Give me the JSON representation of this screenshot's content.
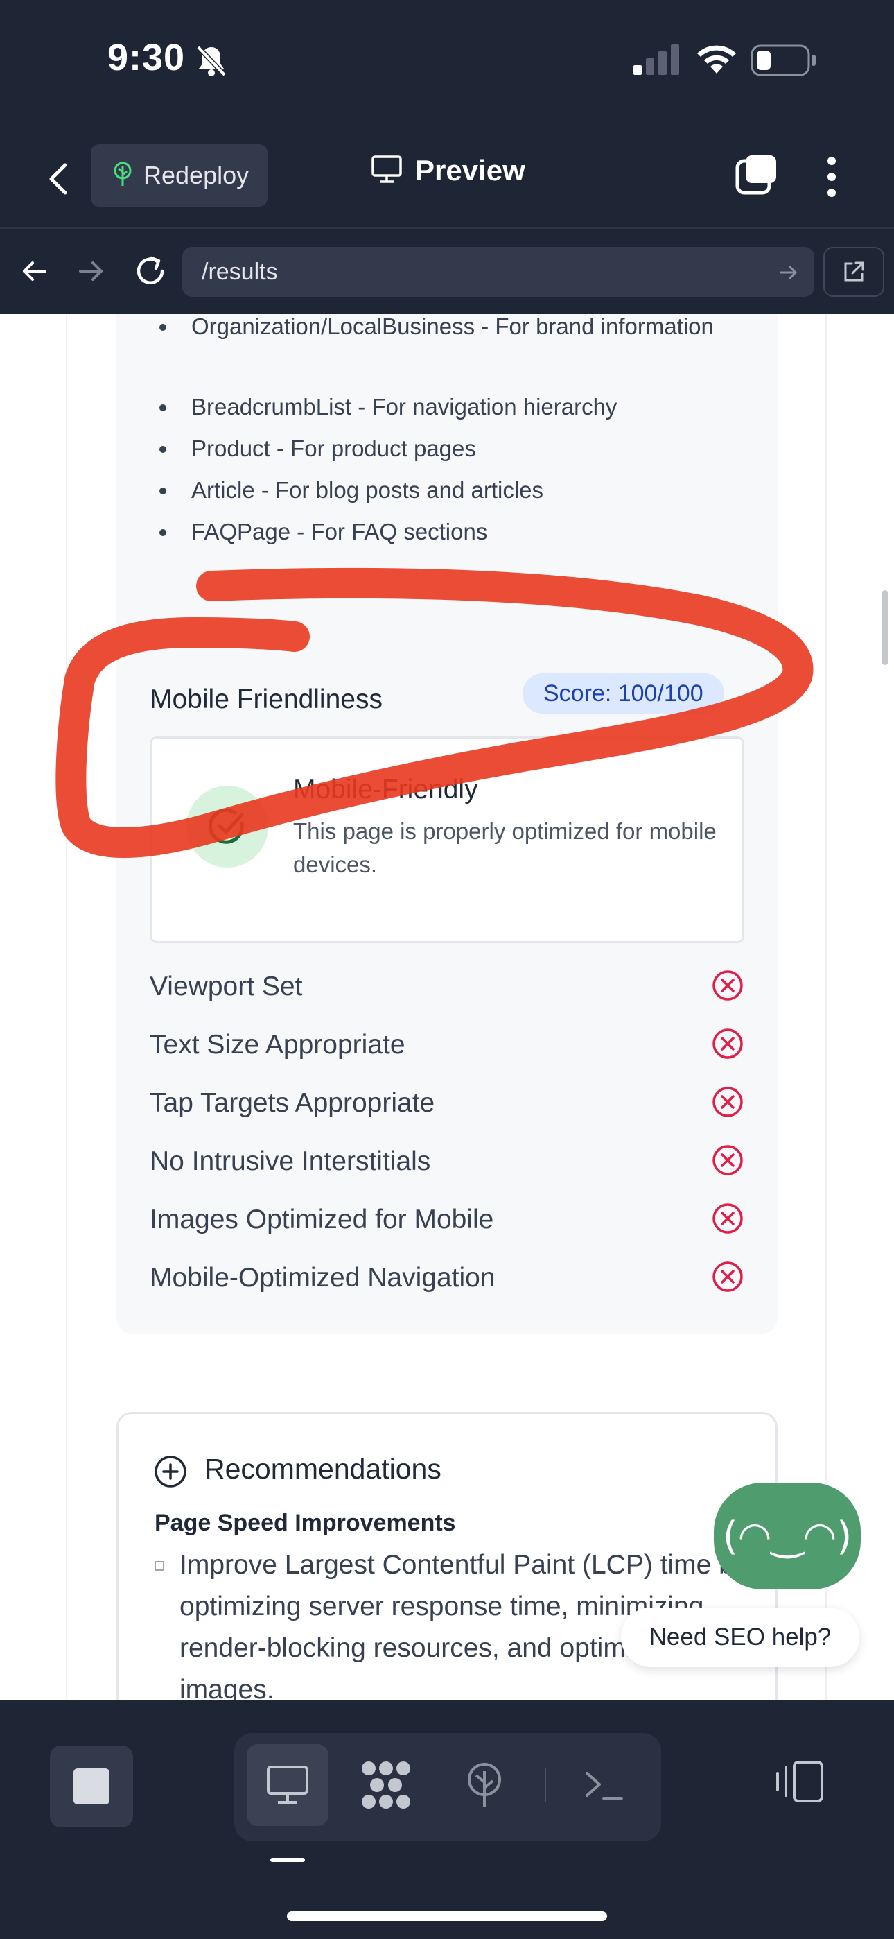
{
  "status_bar": {
    "time": "9:30"
  },
  "header": {
    "redeploy_label": "Redeploy",
    "preview_label": "Preview"
  },
  "url_bar": {
    "url": "/results"
  },
  "schema_list": {
    "items": [
      "Organization/LocalBusiness - For brand information",
      "BreadcrumbList - For navigation hierarchy",
      "Product - For product pages",
      "Article - For blog posts and articles",
      "FAQPage - For FAQ sections"
    ]
  },
  "mobile_friendliness": {
    "title": "Mobile Friendliness",
    "score": "Score: 100/100",
    "status_title": "Mobile-Friendly",
    "status_description": "This page is properly optimized for mobile devices.",
    "checks": [
      {
        "label": "Viewport Set",
        "status": "fail"
      },
      {
        "label": "Text Size Appropriate",
        "status": "fail"
      },
      {
        "label": "Tap Targets Appropriate",
        "status": "fail"
      },
      {
        "label": "No Intrusive Interstitials",
        "status": "fail"
      },
      {
        "label": "Images Optimized for Mobile",
        "status": "fail"
      },
      {
        "label": "Mobile-Optimized Navigation",
        "status": "fail"
      }
    ]
  },
  "recommendations": {
    "title": "Recommendations",
    "subtitle": "Page Speed Improvements",
    "first_item": "Improve Largest Contentful Paint (LCP) time by optimizing server response time, minimizing render-blocking resources, and optimizing images."
  },
  "chat_widget": {
    "face": "(◠‿◠)",
    "bubble": "Need SEO help?"
  },
  "colors": {
    "header_bg": "#1e2535",
    "accent_green": "#4f9d6f",
    "fail_red": "#e11d48",
    "score_badge_text": "#1e40af",
    "annotation_stroke": "#e8391f"
  }
}
